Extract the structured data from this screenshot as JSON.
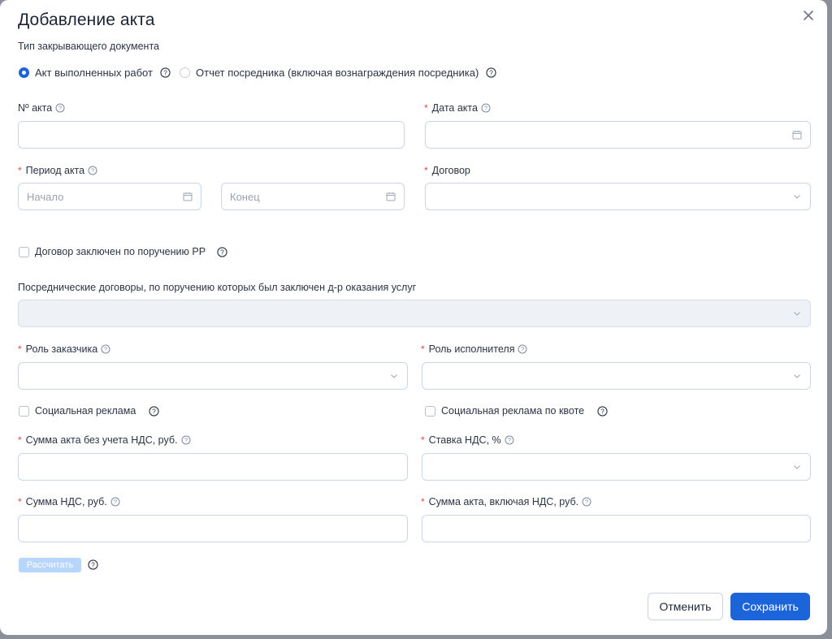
{
  "dialog": {
    "title": "Добавление акта",
    "doc_type_label": "Тип закрывающего документа",
    "options": {
      "act": "Акт выполненных работ",
      "agent_report": "Отчет посредника (включая вознаграждения посредника)"
    }
  },
  "fields": {
    "act_number": "Nº акта",
    "act_date": "Дата акта",
    "period": "Период акта",
    "period_start_placeholder": "Начало",
    "period_end_placeholder": "Конец",
    "contract": "Договор",
    "rr_checkbox": "Договор заключен по поручению РР",
    "intermediary_contracts": "Посреднические договоры, по поручению которых был заключен д-р оказания услуг",
    "customer_role": "Роль заказчика",
    "executor_role": "Роль исполнителя",
    "social_ad": "Социальная реклама",
    "social_ad_quota": "Социальная реклама по квоте",
    "sum_without_vat": "Сумма акта без учета НДС, руб.",
    "vat_rate": "Ставка НДС, %",
    "vat_sum": "Сумма НДС, руб.",
    "sum_with_vat": "Сумма акта, включая НДС, руб."
  },
  "buttons": {
    "calculate": "Рассчитать",
    "cancel": "Отменить",
    "save": "Сохранить"
  },
  "required_mark": "*",
  "colors": {
    "primary": "#1c64d9",
    "required": "#e5484d",
    "calc_disabled": "#b7d6fb"
  }
}
